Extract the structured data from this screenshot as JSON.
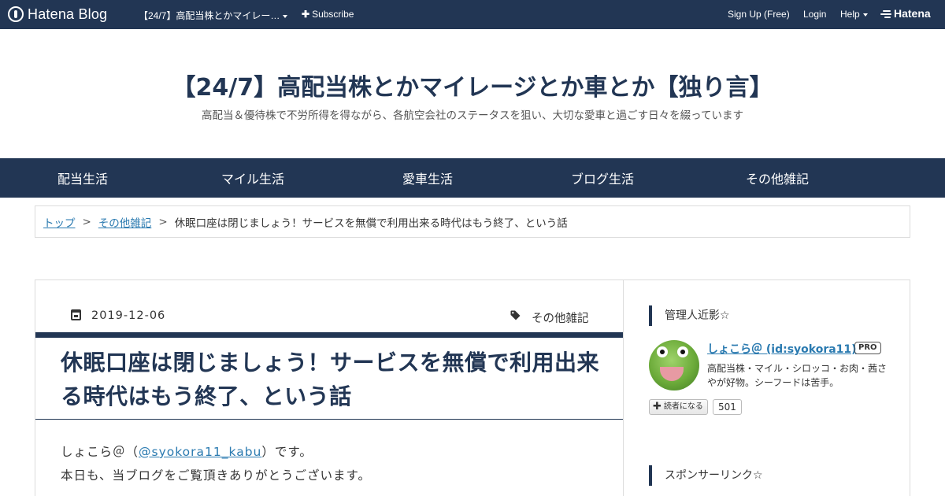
{
  "topbar": {
    "logo_text": "Hatena Blog",
    "blog_menu": "【24/7】高配当株とかマイレー…",
    "subscribe": "Subscribe",
    "signup": "Sign Up (Free)",
    "login": "Login",
    "help": "Help",
    "hatena": "Hatena",
    "colors": {
      "bar": "#223654",
      "text": "#ffffff"
    }
  },
  "blog": {
    "title": "【24/7】高配当株とかマイレージとか車とか【独り言】",
    "description": "高配当＆優待株で不労所得を得ながら、各航空会社のステータスを狙い、大切な愛車と過ごす日々を綴っています"
  },
  "nav": {
    "items": [
      "配当生活",
      "マイル生活",
      "愛車生活",
      "ブログ生活",
      "その他雑記"
    ]
  },
  "breadcrumb": {
    "top": "トップ",
    "category": "その他雑記",
    "separator": ">",
    "current": "休眠口座は閉じましょう！サービスを無償で利用出来る時代はもう終了、という話"
  },
  "entry": {
    "date": "2019-12-06",
    "category": "その他雑記",
    "title": "休眠口座は閉じましょう！サービスを無償で利用出来る時代はもう終了、という話",
    "body_line1_pre": "しょこら＠（",
    "body_line1_link": "@syokora11_kabu",
    "body_line1_post": "）です。",
    "body_line2": "本日も、当ブログをご覧頂きありがとうございます。"
  },
  "sidebar": {
    "profile_heading": "管理人近影☆",
    "user_name": "しょこら＠ (id:syokora11)",
    "pro_badge": "PRO",
    "user_desc": "高配当株・マイル・シロッコ・お肉・茜さやが好物。シーフードは苦手。",
    "reader_button": "読者になる",
    "reader_count": "501",
    "sponsor_heading": "スポンサーリンク☆"
  },
  "icons": {
    "logo": "hatena-blog-logo-icon",
    "calendar": "calendar-icon",
    "tag": "tag-icon",
    "plus": "plus-icon"
  }
}
